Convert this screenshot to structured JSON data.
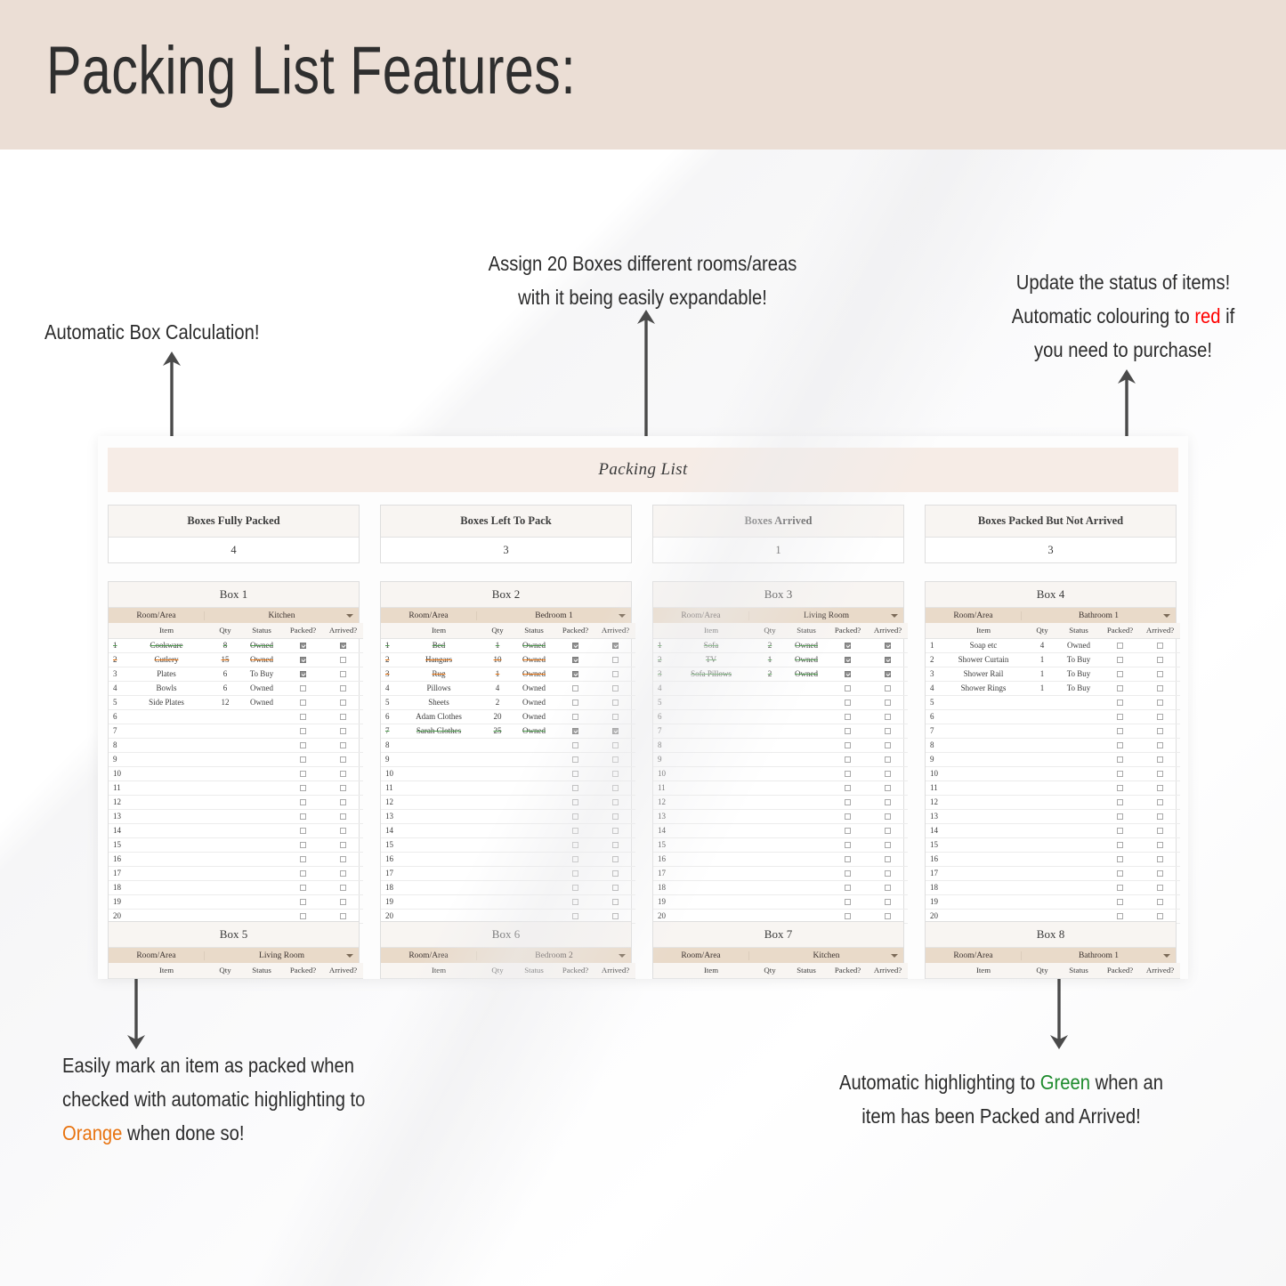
{
  "page": {
    "title": "Packing List Features:"
  },
  "annotations": {
    "box_calc": [
      "Automatic Box Calculation!"
    ],
    "assign": [
      "Assign 20 Boxes different rooms/areas",
      "with it being easily expandable!"
    ],
    "status": {
      "line1": "Update the status of items!",
      "line2_a": "Automatic colouring to ",
      "line2_red": "red",
      "line2_b": " if",
      "line3": "you need to purchase!"
    },
    "packed": {
      "line1": "Easily mark an item as packed when",
      "line2": "checked with automatic highlighting to",
      "line3_orange": "Orange",
      "line3_b": " when done so!"
    },
    "green": {
      "line1_a": "Automatic highlighting to ",
      "line1_green": "Green",
      "line1_b": " when an",
      "line2": "item has been Packed and Arrived!"
    }
  },
  "colors": {
    "red": "#ff0000",
    "orange": "#e8730f",
    "green": "#1c8a2b",
    "band": "#ebded5",
    "banner": "#f6ece6",
    "room_band": "#e9dac9",
    "status_green": "#4c9a4c",
    "status_orange": "#e8730f",
    "status_red": "#e8766e"
  },
  "sheet": {
    "banner_title": "Packing List",
    "summary": [
      {
        "label": "Boxes Fully Packed",
        "value": "4"
      },
      {
        "label": "Boxes Left To Pack",
        "value": "3"
      },
      {
        "label": "Boxes Arrived",
        "value": "1"
      },
      {
        "label": "Boxes Packed But Not Arrived",
        "value": "3"
      }
    ],
    "columns": {
      "item": "Item",
      "qty": "Qty",
      "status": "Status",
      "packed": "Packed?",
      "arrived": "Arrived?"
    },
    "room_label": "Room/Area",
    "row_count": 20,
    "boxes": [
      {
        "title": "Box 1",
        "room": "Kitchen",
        "rows": [
          {
            "n": "1",
            "item": "Cookware",
            "qty": "8",
            "status": "Owned",
            "packed": true,
            "arrived": true,
            "style": "green"
          },
          {
            "n": "2",
            "item": "Cutlery",
            "qty": "15",
            "status": "Owned",
            "packed": true,
            "arrived": false,
            "style": "orange"
          },
          {
            "n": "3",
            "item": "Plates",
            "qty": "6",
            "status": "To Buy",
            "packed": true,
            "arrived": false,
            "style": "red"
          },
          {
            "n": "4",
            "item": "Bowls",
            "qty": "6",
            "status": "Owned",
            "packed": false,
            "arrived": false,
            "style": "plain"
          },
          {
            "n": "5",
            "item": "Side Plates",
            "qty": "12",
            "status": "Owned",
            "packed": false,
            "arrived": false,
            "style": "plain"
          }
        ]
      },
      {
        "title": "Box 2",
        "room": "Bedroom 1",
        "rows": [
          {
            "n": "1",
            "item": "Bed",
            "qty": "1",
            "status": "Owned",
            "packed": true,
            "arrived": true,
            "style": "green"
          },
          {
            "n": "2",
            "item": "Hangars",
            "qty": "10",
            "status": "Owned",
            "packed": true,
            "arrived": false,
            "style": "orange"
          },
          {
            "n": "3",
            "item": "Rug",
            "qty": "1",
            "status": "Owned",
            "packed": true,
            "arrived": false,
            "style": "orange"
          },
          {
            "n": "4",
            "item": "Pillows",
            "qty": "4",
            "status": "Owned",
            "packed": false,
            "arrived": false,
            "style": "plain"
          },
          {
            "n": "5",
            "item": "Sheets",
            "qty": "2",
            "status": "Owned",
            "packed": false,
            "arrived": false,
            "style": "plain"
          },
          {
            "n": "6",
            "item": "Adam Clothes",
            "qty": "20",
            "status": "Owned",
            "packed": false,
            "arrived": false,
            "style": "plain"
          },
          {
            "n": "7",
            "item": "Sarah Clothes",
            "qty": "25",
            "status": "Owned",
            "packed": true,
            "arrived": true,
            "style": "green"
          }
        ]
      },
      {
        "title": "Box 3",
        "room": "Living Room",
        "rows": [
          {
            "n": "1",
            "item": "Sofa",
            "qty": "2",
            "status": "Owned",
            "packed": true,
            "arrived": true,
            "style": "green"
          },
          {
            "n": "2",
            "item": "TV",
            "qty": "1",
            "status": "Owned",
            "packed": true,
            "arrived": true,
            "style": "green"
          },
          {
            "n": "3",
            "item": "Sofa Pillows",
            "qty": "2",
            "status": "Owned",
            "packed": true,
            "arrived": true,
            "style": "green"
          }
        ]
      },
      {
        "title": "Box 4",
        "room": "Bathroom 1",
        "rows": [
          {
            "n": "1",
            "item": "Soap etc",
            "qty": "4",
            "status": "Owned",
            "packed": false,
            "arrived": false,
            "style": "plain"
          },
          {
            "n": "2",
            "item": "Shower Curtain",
            "qty": "1",
            "status": "To Buy",
            "packed": false,
            "arrived": false,
            "style": "red"
          },
          {
            "n": "3",
            "item": "Shower Rail",
            "qty": "1",
            "status": "To Buy",
            "packed": false,
            "arrived": false,
            "style": "red"
          },
          {
            "n": "4",
            "item": "Shower Rings",
            "qty": "1",
            "status": "To Buy",
            "packed": false,
            "arrived": false,
            "style": "red"
          }
        ]
      }
    ],
    "boxes_bottom": [
      {
        "title": "Box 5",
        "room": "Living Room"
      },
      {
        "title": "Box 6",
        "room": "Bedroom 2"
      },
      {
        "title": "Box 7",
        "room": "Kitchen"
      },
      {
        "title": "Box 8",
        "room": "Bathroom 1"
      }
    ]
  }
}
